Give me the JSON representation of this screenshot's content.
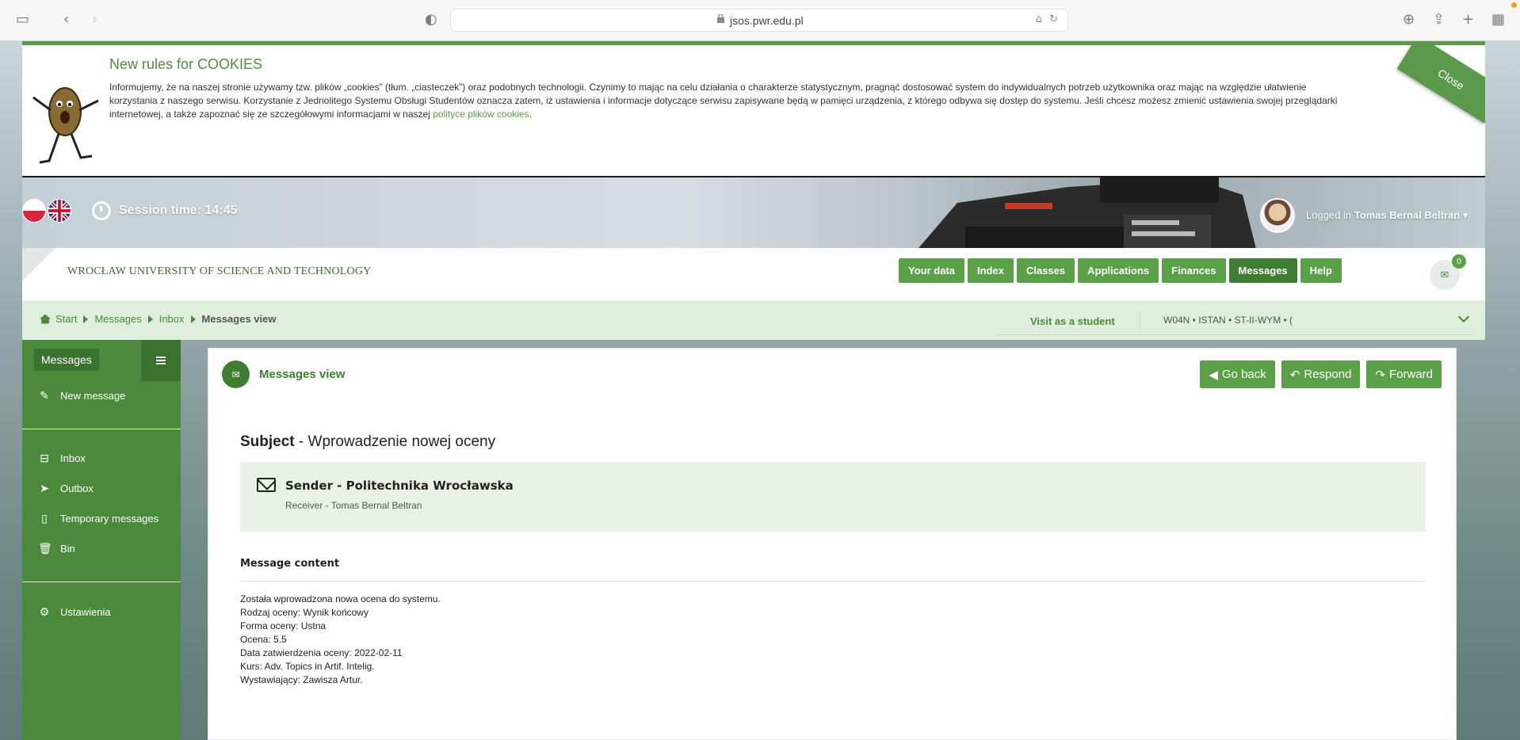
{
  "browser": {
    "url": "jsos.pwr.edu.pl"
  },
  "cookies": {
    "title": "New rules for COOKIES",
    "text": "Informujemy, że na naszej stronie używamy tzw. plików „cookies” (tłum. „ciasteczek”) oraz podobnych technologii. Czynimy to mając na celu działania o charakterze statystycznym, pragnąć dostosować system do indywidualnych potrzeb użytkownika oraz mając na względzie ułatwienie korzystania z naszego serwisu. Korzystanie z Jednolitego Systemu Obsługi Studentów oznacza zatem, iż ustawienia i informacje dotyczące serwisu zapisywane będą w pamięci urządzenia, z którego odbywa się dostęp do systemu. Jeśli chcesz możesz zmienić ustawienia swojej przeglądarki internetowej, a także zapoznać się ze szczegółowymi informacjami w naszej",
    "link": "polityce plików cookies",
    "close": "Close"
  },
  "header": {
    "session_time": "Session time: 14:45",
    "logged_in_label": "Logged in",
    "user_name": "Tomas Bernal Beltran",
    "university": "WROCŁAW UNIVERSITY OF SCIENCE AND TECHNOLOGY"
  },
  "nav": {
    "items": [
      "Your data",
      "Index",
      "Classes",
      "Applications",
      "Finances",
      "Messages",
      "Help"
    ],
    "active": "Messages",
    "mail_count": "0"
  },
  "breadcrumb": {
    "items": [
      "Start",
      "Messages",
      "Inbox"
    ],
    "current": "Messages view",
    "visit_as_student": "Visit as a student",
    "program": "W04N • ISTAN • ST-II-WYM • ("
  },
  "sidebar": {
    "title": "Messages",
    "new_message": "New message",
    "items": [
      {
        "label": "Inbox",
        "icon": "inbox-icon"
      },
      {
        "label": "Outbox",
        "icon": "paper-plane-icon"
      },
      {
        "label": "Temporary messages",
        "icon": "file-icon"
      },
      {
        "label": "Bin",
        "icon": "trash-icon"
      }
    ],
    "settings": "Ustawienia"
  },
  "message": {
    "panel_title": "Messages view",
    "go_back": "Go back",
    "respond": "Respond",
    "forward": "Forward",
    "subject_label": "Subject",
    "subject": "- Wprowadzenie nowej oceny",
    "sender": "Sender - Politechnika Wrocławska",
    "receiver": "Receiver - Tomas Bernal Beltran",
    "content_label": "Message content",
    "content_lines": [
      "Została wprowadzona nowa ocena do systemu.",
      "Rodzaj oceny: Wynik końcowy",
      "Forma oceny: Ustna",
      "Ocena: 5.5",
      "Data zatwierdzenia oceny: 2022-02-11",
      "Kurs: Adv. Topics in Artif. Intelig.",
      "Wystawiający: Zawisza Artur."
    ]
  },
  "colors": {
    "brand_green": "#5aa046",
    "dark_green": "#3e7d32",
    "sidebar_green": "#4a8a3a"
  }
}
